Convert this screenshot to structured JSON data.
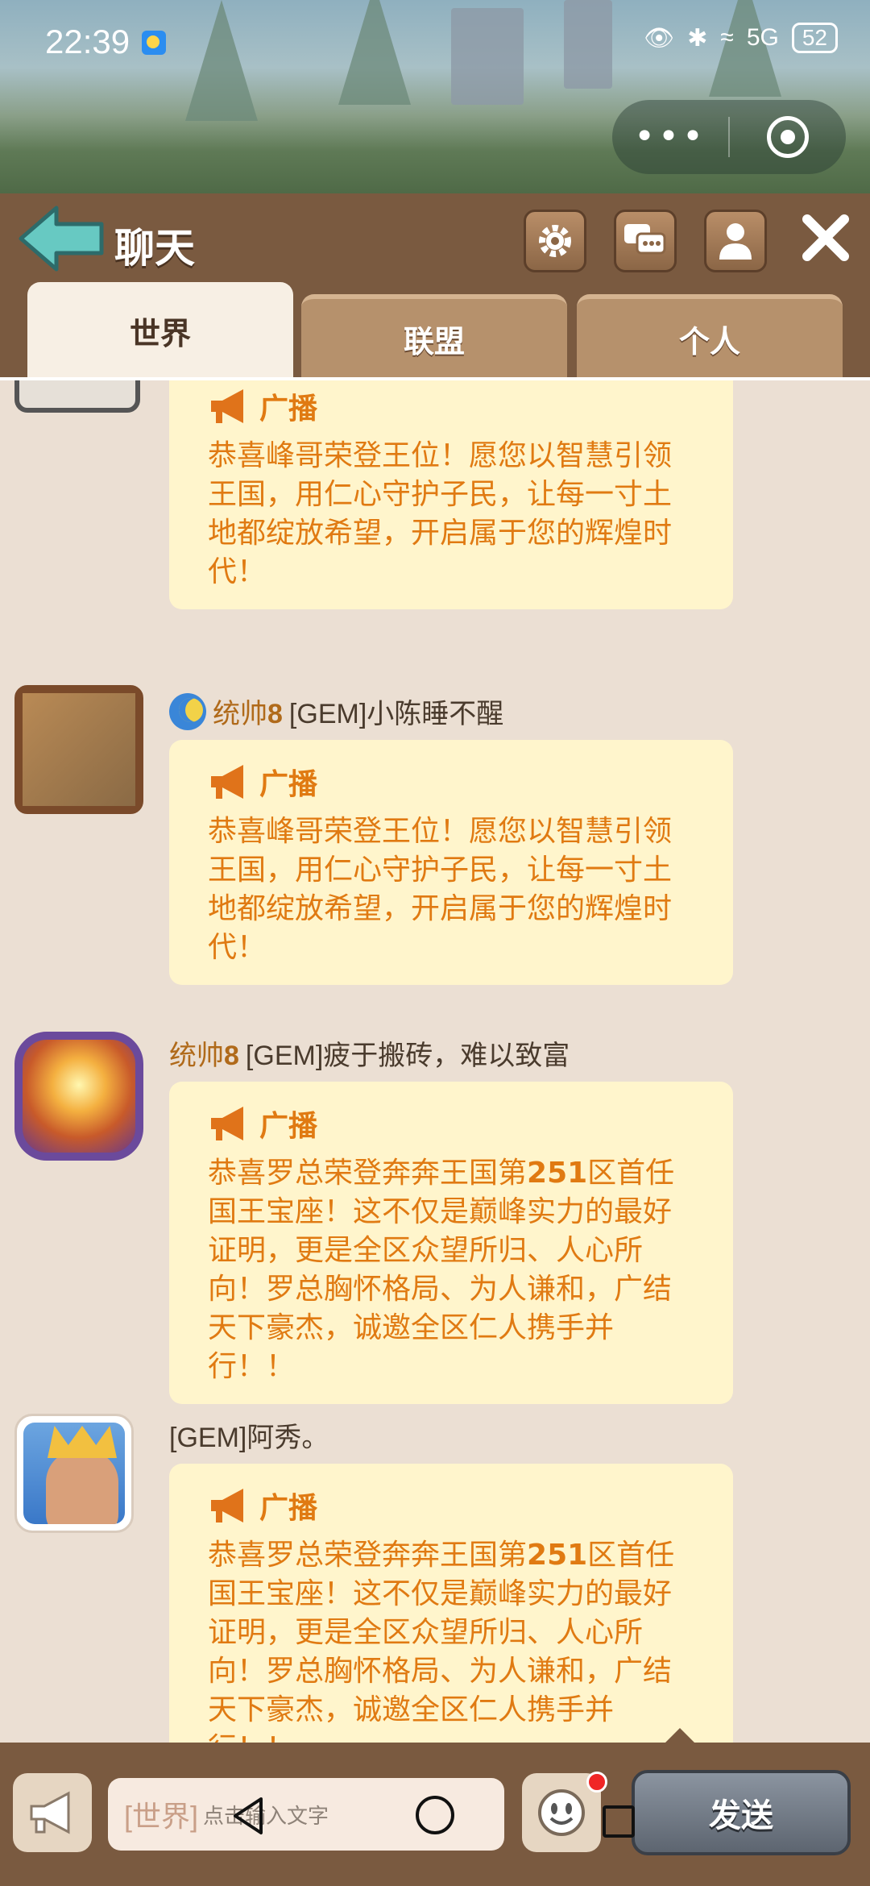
{
  "status_bar": {
    "time": "22:39",
    "network": "5G",
    "battery": "52"
  },
  "header": {
    "title": "聊天",
    "tabs": [
      {
        "label": "世界",
        "active": true
      },
      {
        "label": "联盟",
        "active": false
      },
      {
        "label": "个人",
        "active": false
      }
    ]
  },
  "messages": [
    {
      "sender": "",
      "badge_label": "广播",
      "text": "恭喜峰哥荣登王位！愿您以智慧引领王国，用仁心守护子民，让每一寸土地都绽放希望，开启属于您的辉煌时代！"
    },
    {
      "rank_prefix": "统帅",
      "rank_level": "8",
      "sender": "[GEM]小陈睡不醒",
      "badge_label": "广播",
      "text": "恭喜峰哥荣登王位！愿您以智慧引领王国，用仁心守护子民，让每一寸土地都绽放希望，开启属于您的辉煌时代！"
    },
    {
      "rank_prefix": "统帅",
      "rank_level": "8",
      "sender": "[GEM]疲于搬砖，难以致富",
      "badge_label": "广播",
      "text_before": "恭喜罗总荣登奔奔王国第",
      "text_num": "251",
      "text_after": "区首任国王宝座！这不仅是巅峰实力的最好证明，更是全区众望所归、人心所向！罗总胸怀格局、为人谦和，广结天下豪杰，诚邀全区仁人携手并行！！"
    },
    {
      "sender": "[GEM]阿秀。",
      "badge_label": "广播",
      "text_before": "恭喜罗总荣登奔奔王国第",
      "text_num": "251",
      "text_after": "区首任国王宝座！这不仅是巅峰实力的最好证明，更是全区众望所归、人心所向！罗总胸怀格局、为人谦和，广结天下豪杰，诚邀全区仁人携手并行！！"
    }
  ],
  "input_bar": {
    "channel": "[世界]",
    "placeholder": "点击输入文字",
    "send_label": "发送"
  },
  "colors": {
    "accent_orange": "#e07a12",
    "bubble_bg": "#fff5cc",
    "header_brown": "#7a5a40",
    "chat_bg": "#ebdfd3"
  }
}
